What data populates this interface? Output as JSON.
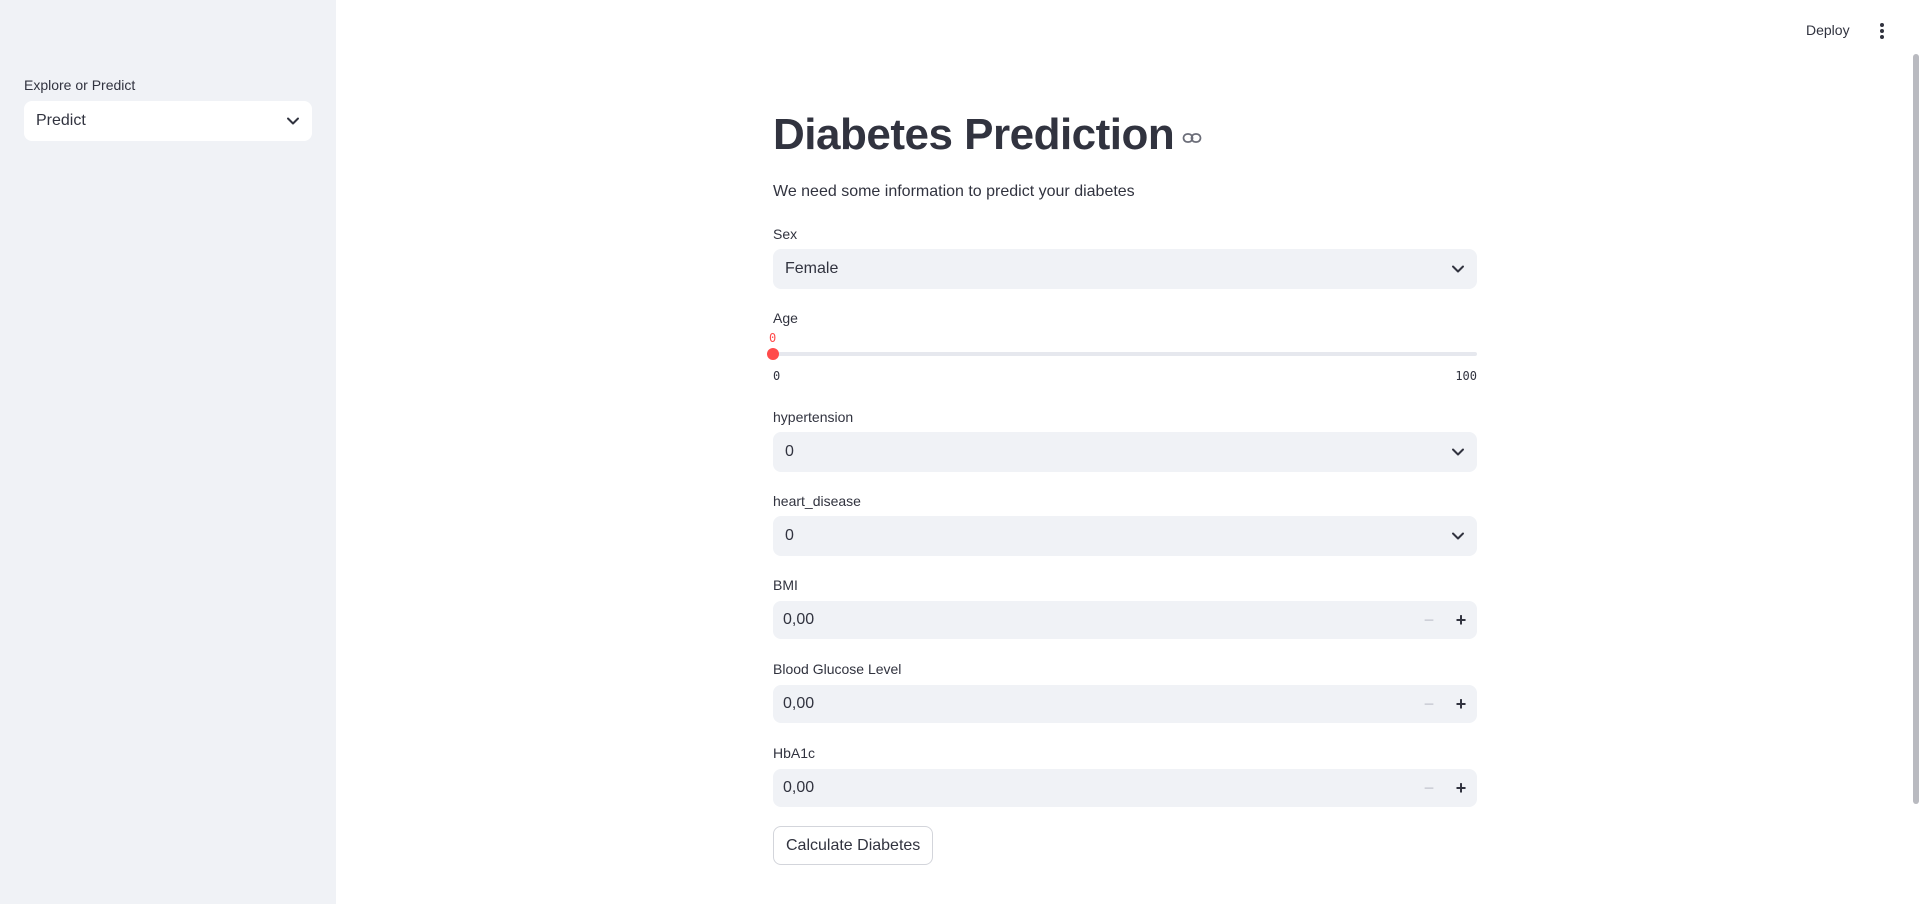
{
  "sidebar": {
    "label": "Explore or Predict",
    "selected": "Predict"
  },
  "header": {
    "deploy_label": "Deploy"
  },
  "main": {
    "title": "Diabetes Prediction",
    "subtitle": "We need some information to predict your diabetes",
    "sex": {
      "label": "Sex",
      "value": "Female"
    },
    "age": {
      "label": "Age",
      "value": "0",
      "min": "0",
      "max": "100",
      "fraction": 0
    },
    "hypertension": {
      "label": "hypertension",
      "value": "0"
    },
    "heart_disease": {
      "label": "heart_disease",
      "value": "0"
    },
    "bmi": {
      "label": "BMI",
      "value": "0,00"
    },
    "glucose": {
      "label": "Blood Glucose Level",
      "value": "0,00"
    },
    "hba1c": {
      "label": "HbA1c",
      "value": "0,00"
    },
    "button_label": "Calculate Diabetes"
  },
  "colors": {
    "accent": "#ff4b4b",
    "sidebar_bg": "#f0f2f6",
    "text": "#31333f"
  }
}
